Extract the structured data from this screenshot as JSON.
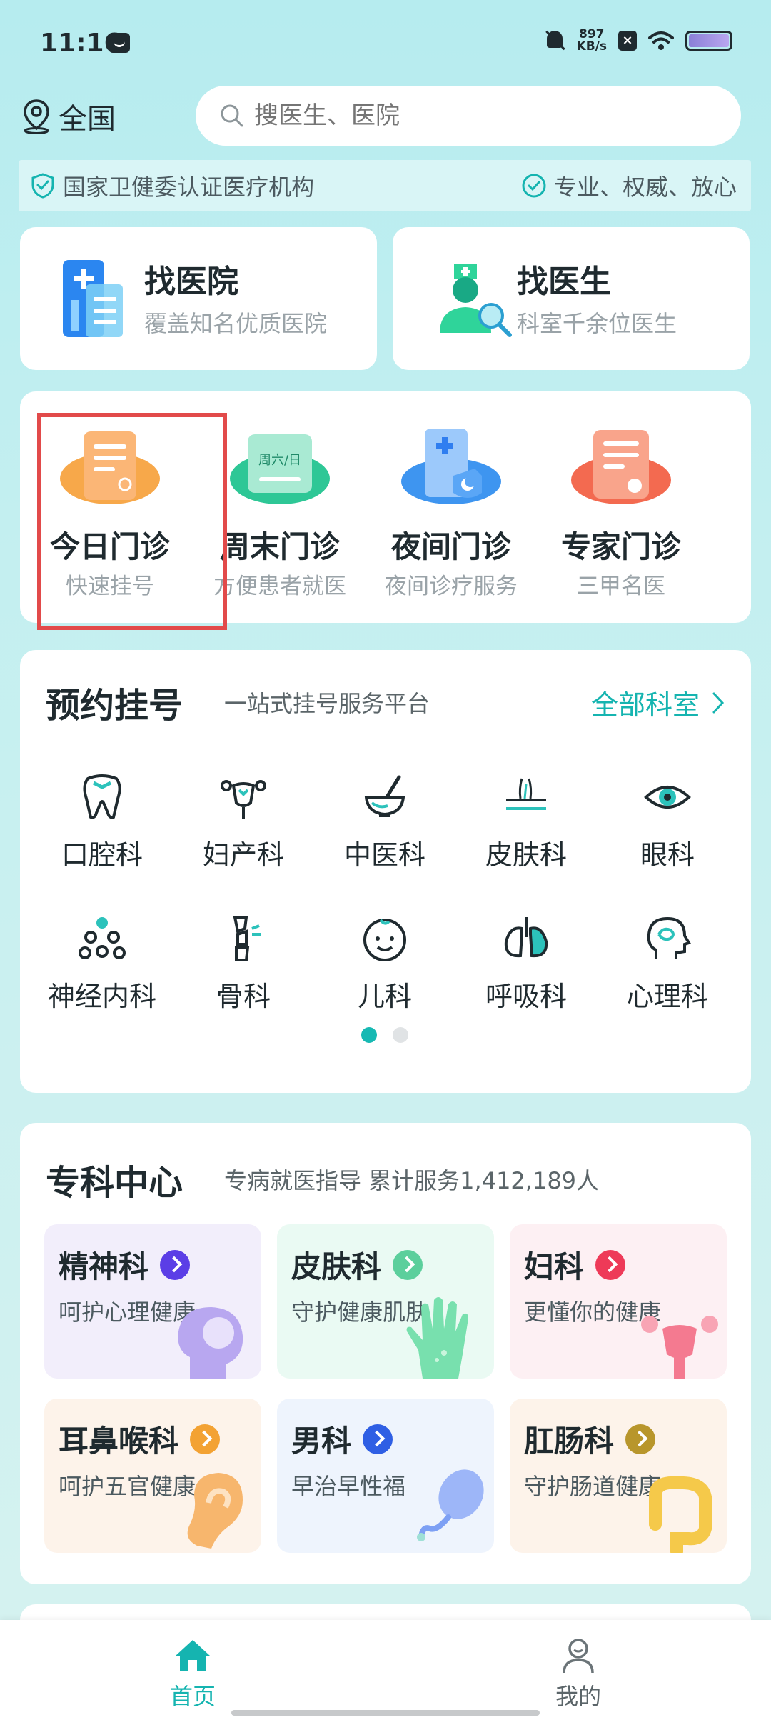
{
  "status_bar": {
    "time": "11:16",
    "net_speed_value": "897",
    "net_speed_unit": "KB/s",
    "x_badge": "×"
  },
  "location": {
    "label": "全国"
  },
  "search": {
    "placeholder": "搜医生、医院"
  },
  "cert_banner": {
    "left": "国家卫健委认证医疗机构",
    "right": "专业、权威、放心"
  },
  "find_cards": [
    {
      "title": "找医院",
      "subtitle": "覆盖知名优质医院"
    },
    {
      "title": "找医生",
      "subtitle": "科室千余位医生"
    }
  ],
  "clinics": [
    {
      "title": "今日门诊",
      "subtitle": "快速挂号"
    },
    {
      "title": "周末门诊",
      "subtitle": "方便患者就医",
      "icon_text": "周六/日"
    },
    {
      "title": "夜间门诊",
      "subtitle": "夜间诊疗服务"
    },
    {
      "title": "专家门诊",
      "subtitle": "三甲名医"
    }
  ],
  "appointment": {
    "title": "预约挂号",
    "subtitle": "一站式挂号服务平台",
    "all_link": "全部科室",
    "departments": [
      {
        "label": "口腔科",
        "icon": "tooth-icon"
      },
      {
        "label": "妇产科",
        "icon": "uterus-icon"
      },
      {
        "label": "中医科",
        "icon": "mortar-icon"
      },
      {
        "label": "皮肤科",
        "icon": "skin-icon"
      },
      {
        "label": "眼科",
        "icon": "eye-icon"
      },
      {
        "label": "神经内科",
        "icon": "neuron-icon"
      },
      {
        "label": "骨科",
        "icon": "bone-icon"
      },
      {
        "label": "儿科",
        "icon": "baby-face-icon"
      },
      {
        "label": "呼吸科",
        "icon": "lungs-icon"
      },
      {
        "label": "心理科",
        "icon": "head-brain-icon"
      }
    ],
    "page_count": 2,
    "active_page": 1
  },
  "specialty": {
    "title": "专科中心",
    "subtitle": "专病就医指导 累计服务1,412,189人",
    "cards": [
      {
        "name": "精神科",
        "desc": "呵护心理健康",
        "bg": "#f2eefb",
        "accent": "#5b3ee6"
      },
      {
        "name": "皮肤科",
        "desc": "守护健康肌肤",
        "bg": "#eafaf3",
        "accent": "#5ccf9c"
      },
      {
        "name": "妇科",
        "desc": "更懂你的健康",
        "bg": "#fdf0f3",
        "accent": "#ee3a58"
      },
      {
        "name": "耳鼻喉科",
        "desc": "呵护五官健康",
        "bg": "#fdf3ea",
        "accent": "#f3a233"
      },
      {
        "name": "男科",
        "desc": "早治早性福",
        "bg": "#eef4fd",
        "accent": "#2f5fe4"
      },
      {
        "name": "肛肠科",
        "desc": "守护肠道健康",
        "bg": "#fdf3ea",
        "accent": "#b8962c"
      }
    ]
  },
  "bottom_nav": [
    {
      "label": "首页",
      "icon": "home-icon",
      "active": true
    },
    {
      "label": "我的",
      "icon": "user-icon",
      "active": false
    }
  ],
  "colors": {
    "accent": "#15b4b0",
    "highlight_box": "#e24a4a"
  }
}
